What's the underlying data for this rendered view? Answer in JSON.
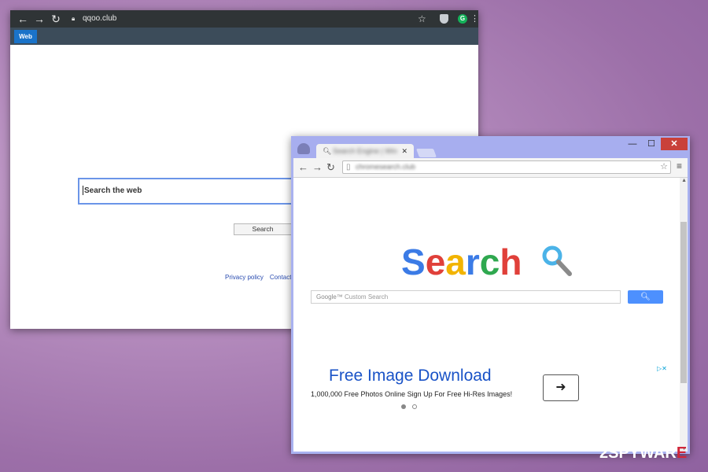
{
  "back_window": {
    "url": "qqoo.club",
    "tab_label": "Web",
    "search_placeholder": "Search the web",
    "search_button": "Search",
    "links": [
      "Privacy policy",
      "Contact U"
    ],
    "ext_badge": "G",
    "colors": {
      "chrome": "#2f3436",
      "tab_bar": "#3c4c5a",
      "tab_accent": "#1a73c9"
    }
  },
  "front_window": {
    "tab_title": "Search Engine | Win",
    "url": "chromesearch.club",
    "logo_letters": [
      "S",
      "e",
      "a",
      "r",
      "c",
      "h"
    ],
    "logo_colors": [
      "#3b7be6",
      "#e0403a",
      "#f2b400",
      "#3b7be6",
      "#2fa84f",
      "#e0403a"
    ],
    "google_label": "Google™",
    "google_placeholder": "Custom Search",
    "ad": {
      "title": "Free Image Download",
      "text": "1,000,000 Free Photos Online Sign Up For Free Hi-Res Images!",
      "choices": "▷✕"
    },
    "icons": [
      "incognito-icon",
      "back-arrow-icon",
      "forward-arrow-icon",
      "reload-icon",
      "page-icon",
      "star-icon",
      "menu-icon",
      "magnifier-icon",
      "arrow-right-icon"
    ]
  },
  "watermark": {
    "prefix": "2SPYWAR",
    "accent": "E"
  }
}
